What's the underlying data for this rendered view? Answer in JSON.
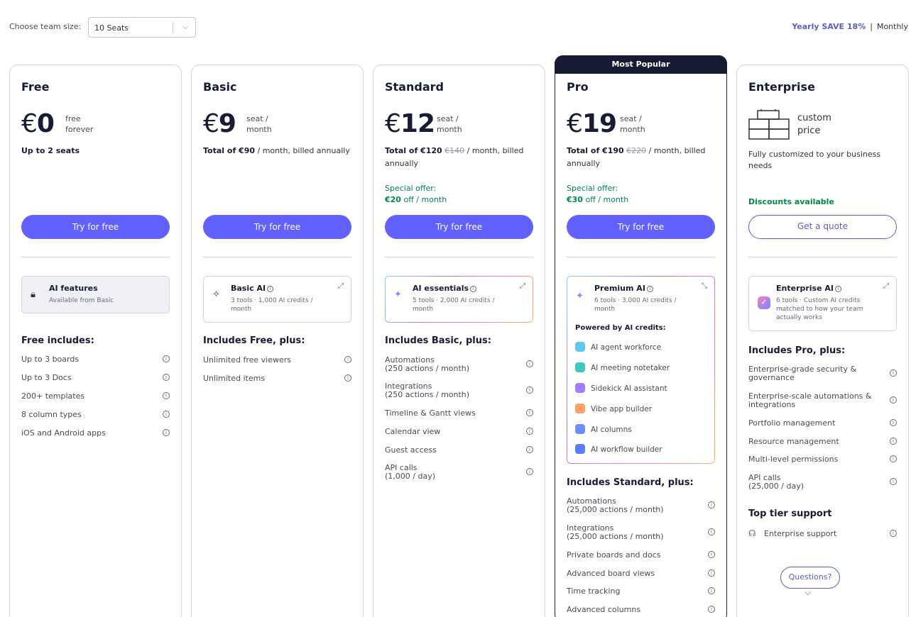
{
  "header": {
    "team_label": "Choose team size:",
    "seats_value": "10 Seats",
    "yearly_label": "Yearly SAVE 18%",
    "separator": "|",
    "monthly_label": "Monthly"
  },
  "plans": {
    "free": {
      "name": "Free",
      "price": "0",
      "period_1": "free",
      "period_2": "forever",
      "subline": "Up to 2 seats",
      "cta": "Try for free",
      "ai_title": "AI features",
      "ai_desc": "Available from Basic",
      "includes_title": "Free includes:",
      "features": [
        "Up to 3 boards",
        "Up to 3 Docs",
        "200+ templates",
        "8 column types",
        "iOS and Android apps"
      ]
    },
    "basic": {
      "name": "Basic",
      "price": "9",
      "period_1": "seat /",
      "period_2": "month",
      "total_bold": "Total of €90",
      "total_rest": " / month, billed annually",
      "cta": "Try for free",
      "ai_title": "Basic AI",
      "ai_desc": "3 tools · 1,000 AI credits / month",
      "includes_title": "Includes Free, plus:",
      "features": [
        "Unlimited free viewers",
        "Unlimited items"
      ]
    },
    "standard": {
      "name": "Standard",
      "price": "12",
      "period_1": "seat /",
      "period_2": "month",
      "total_bold": "Total of €120",
      "total_strike": "€140",
      "total_rest": " / month, billed annually",
      "offer_label": "Special offer:",
      "offer_bold": "€20",
      "offer_rest": " off / month",
      "cta": "Try for free",
      "ai_title": "AI essentials",
      "ai_desc": "5 tools · 2,000 AI credits / month",
      "includes_title": "Includes Basic, plus:",
      "features": [
        {
          "l1": "Automations",
          "l2": "(250 actions / month)"
        },
        {
          "l1": "Integrations",
          "l2": "(250 actions / month)"
        },
        {
          "l1": "Timeline & Gantt views",
          "l2": ""
        },
        {
          "l1": "Calendar view",
          "l2": ""
        },
        {
          "l1": "Guest access",
          "l2": ""
        },
        {
          "l1": "API calls",
          "l2": "(1,000 / day)"
        }
      ]
    },
    "pro": {
      "badge": "Most Popular",
      "name": "Pro",
      "price": "19",
      "period_1": "seat /",
      "period_2": "month",
      "total_bold": "Total of €190",
      "total_strike": "€220",
      "total_rest": " / month, billed annually",
      "offer_label": "Special offer:",
      "offer_bold": "€30",
      "offer_rest": " off / month",
      "cta": "Try for free",
      "ai_title": "Premium AI",
      "ai_desc": "6 tools · 3,000 AI credits / month",
      "powered_label": "Powered by AI credits:",
      "credits": [
        {
          "label": "AI agent workforce",
          "icon": "agent-icon",
          "color": "#5fc8e8"
        },
        {
          "label": "AI meeting notetaker",
          "icon": "notetaker-icon",
          "color": "#3fc7c0"
        },
        {
          "label": "Sidekick AI assistant",
          "icon": "sidekick-icon",
          "color": "#a47cff"
        },
        {
          "label": "Vibe app builder",
          "icon": "vibe-icon",
          "color": "#ff9f6b"
        },
        {
          "label": "AI columns",
          "icon": "columns-icon",
          "color": "#6c8cff"
        },
        {
          "label": "AI workflow builder",
          "icon": "workflow-icon",
          "color": "#5b7cff"
        }
      ],
      "includes_title": "Includes Standard, plus:",
      "features": [
        {
          "l1": "Automations",
          "l2": "(25,000 actions / month)"
        },
        {
          "l1": "Integrations",
          "l2": "(25,000 actions / month)"
        },
        {
          "l1": "Private boards and docs",
          "l2": ""
        },
        {
          "l1": "Advanced board views",
          "l2": ""
        },
        {
          "l1": "Time tracking",
          "l2": ""
        },
        {
          "l1": "Advanced columns",
          "l2": ""
        }
      ]
    },
    "enterprise": {
      "name": "Enterprise",
      "price_1": "custom",
      "price_2": "price",
      "subline": "Fully customized to your business needs",
      "discount": "Discounts available",
      "cta": "Get a quote",
      "ai_title": "Enterprise AI",
      "ai_desc": "6 tools · Custom AI credits matched to how your team actually works",
      "includes_title": "Includes Pro, plus:",
      "features": [
        {
          "l1": "Enterprise-grade security &",
          "l2": "governance"
        },
        {
          "l1": "Enterprise-scale automations &",
          "l2": "integrations"
        },
        {
          "l1": "Portfolio management",
          "l2": ""
        },
        {
          "l1": "Resource management",
          "l2": ""
        },
        {
          "l1": "Multi-level permissions",
          "l2": ""
        },
        {
          "l1": "API calls",
          "l2": "(25,000 / day)"
        }
      ],
      "support_title": "Top tier support",
      "support_item": "Enterprise support"
    }
  },
  "questions_label": "Questions?",
  "colors": {
    "accent": "#6161ff",
    "offer": "#00854d",
    "dark": "#181b34"
  }
}
